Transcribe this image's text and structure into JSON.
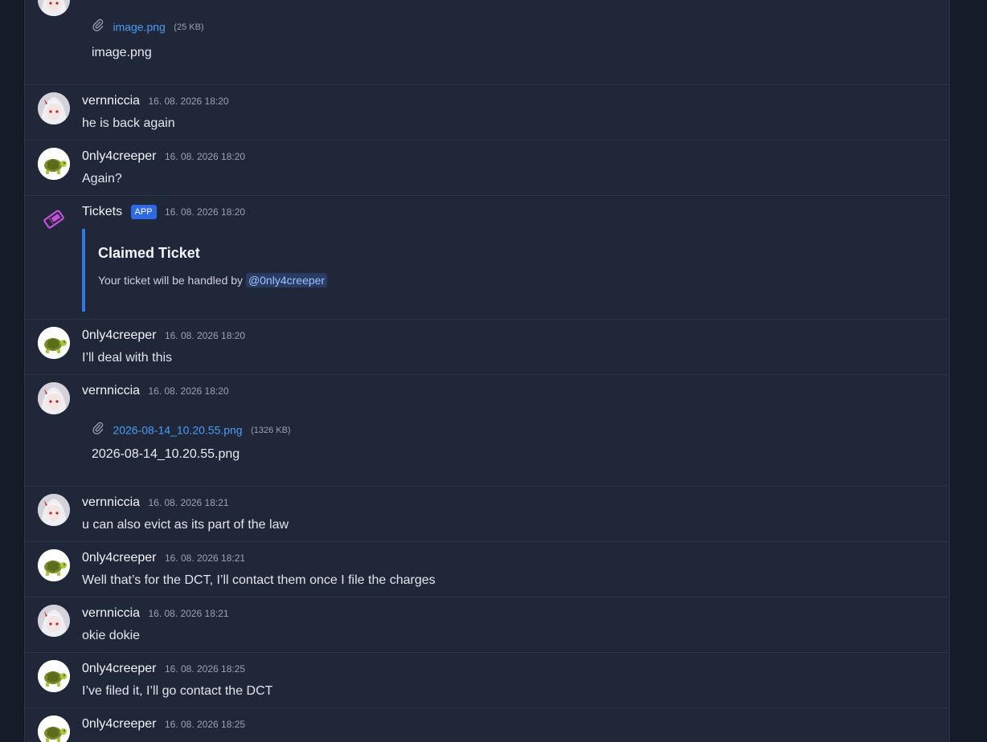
{
  "messages": [
    {
      "kind": "attachment",
      "author": "",
      "time": "",
      "file_link": "image.png",
      "file_size": "(25 KB)",
      "file_name": "image.png"
    },
    {
      "kind": "text",
      "author": "vernniccia",
      "time": "16. 08. 2026 18:20",
      "text": "he is back again",
      "avatar": "anime-girl-avatar"
    },
    {
      "kind": "text",
      "author": "0nly4creeper",
      "time": "16. 08. 2026 18:20",
      "text": "Again?",
      "avatar": "turtle-avatar"
    },
    {
      "kind": "embed",
      "author": "Tickets",
      "badge": "APP",
      "time": "16. 08. 2026 18:20",
      "embed_title": "Claimed Ticket",
      "embed_text": "Your ticket will be handled by",
      "mention": "@0nly4creeper",
      "avatar": "ticket-icon"
    },
    {
      "kind": "text",
      "author": "0nly4creeper",
      "time": "16. 08. 2026 18:20",
      "text": "I’ll deal with this",
      "avatar": "turtle-avatar"
    },
    {
      "kind": "attachment",
      "author": "vernniccia",
      "time": "16. 08. 2026 18:20",
      "file_link": "2026-08-14_10.20.55.png",
      "file_size": "(1326 KB)",
      "file_name": "2026-08-14_10.20.55.png",
      "avatar": "anime-girl-avatar"
    },
    {
      "kind": "text",
      "author": "vernniccia",
      "time": "16. 08. 2026 18:21",
      "text": "u can also evict as its part of the law",
      "avatar": "anime-girl-avatar"
    },
    {
      "kind": "text",
      "author": "0nly4creeper",
      "time": "16. 08. 2026 18:21",
      "text": "Well that’s for the DCT, I’ll contact them once I file the charges",
      "avatar": "turtle-avatar"
    },
    {
      "kind": "text",
      "author": "vernniccia",
      "time": "16. 08. 2026 18:21",
      "text": "okie dokie",
      "avatar": "anime-girl-avatar"
    },
    {
      "kind": "text",
      "author": "0nly4creeper",
      "time": "16. 08. 2026 18:25",
      "text": "I’ve filed it, I’ll go contact the DCT",
      "avatar": "turtle-avatar"
    },
    {
      "kind": "text",
      "author": "0nly4creeper",
      "time": "16. 08. 2026 18:25",
      "text": "",
      "avatar": "turtle-avatar"
    }
  ],
  "colors": {
    "background": "#141b29",
    "panel": "#1f2738",
    "link": "#4e9cf5",
    "accent": "#3279e6",
    "badge": "#2f6ae6",
    "ticket": "#c74fd9"
  }
}
